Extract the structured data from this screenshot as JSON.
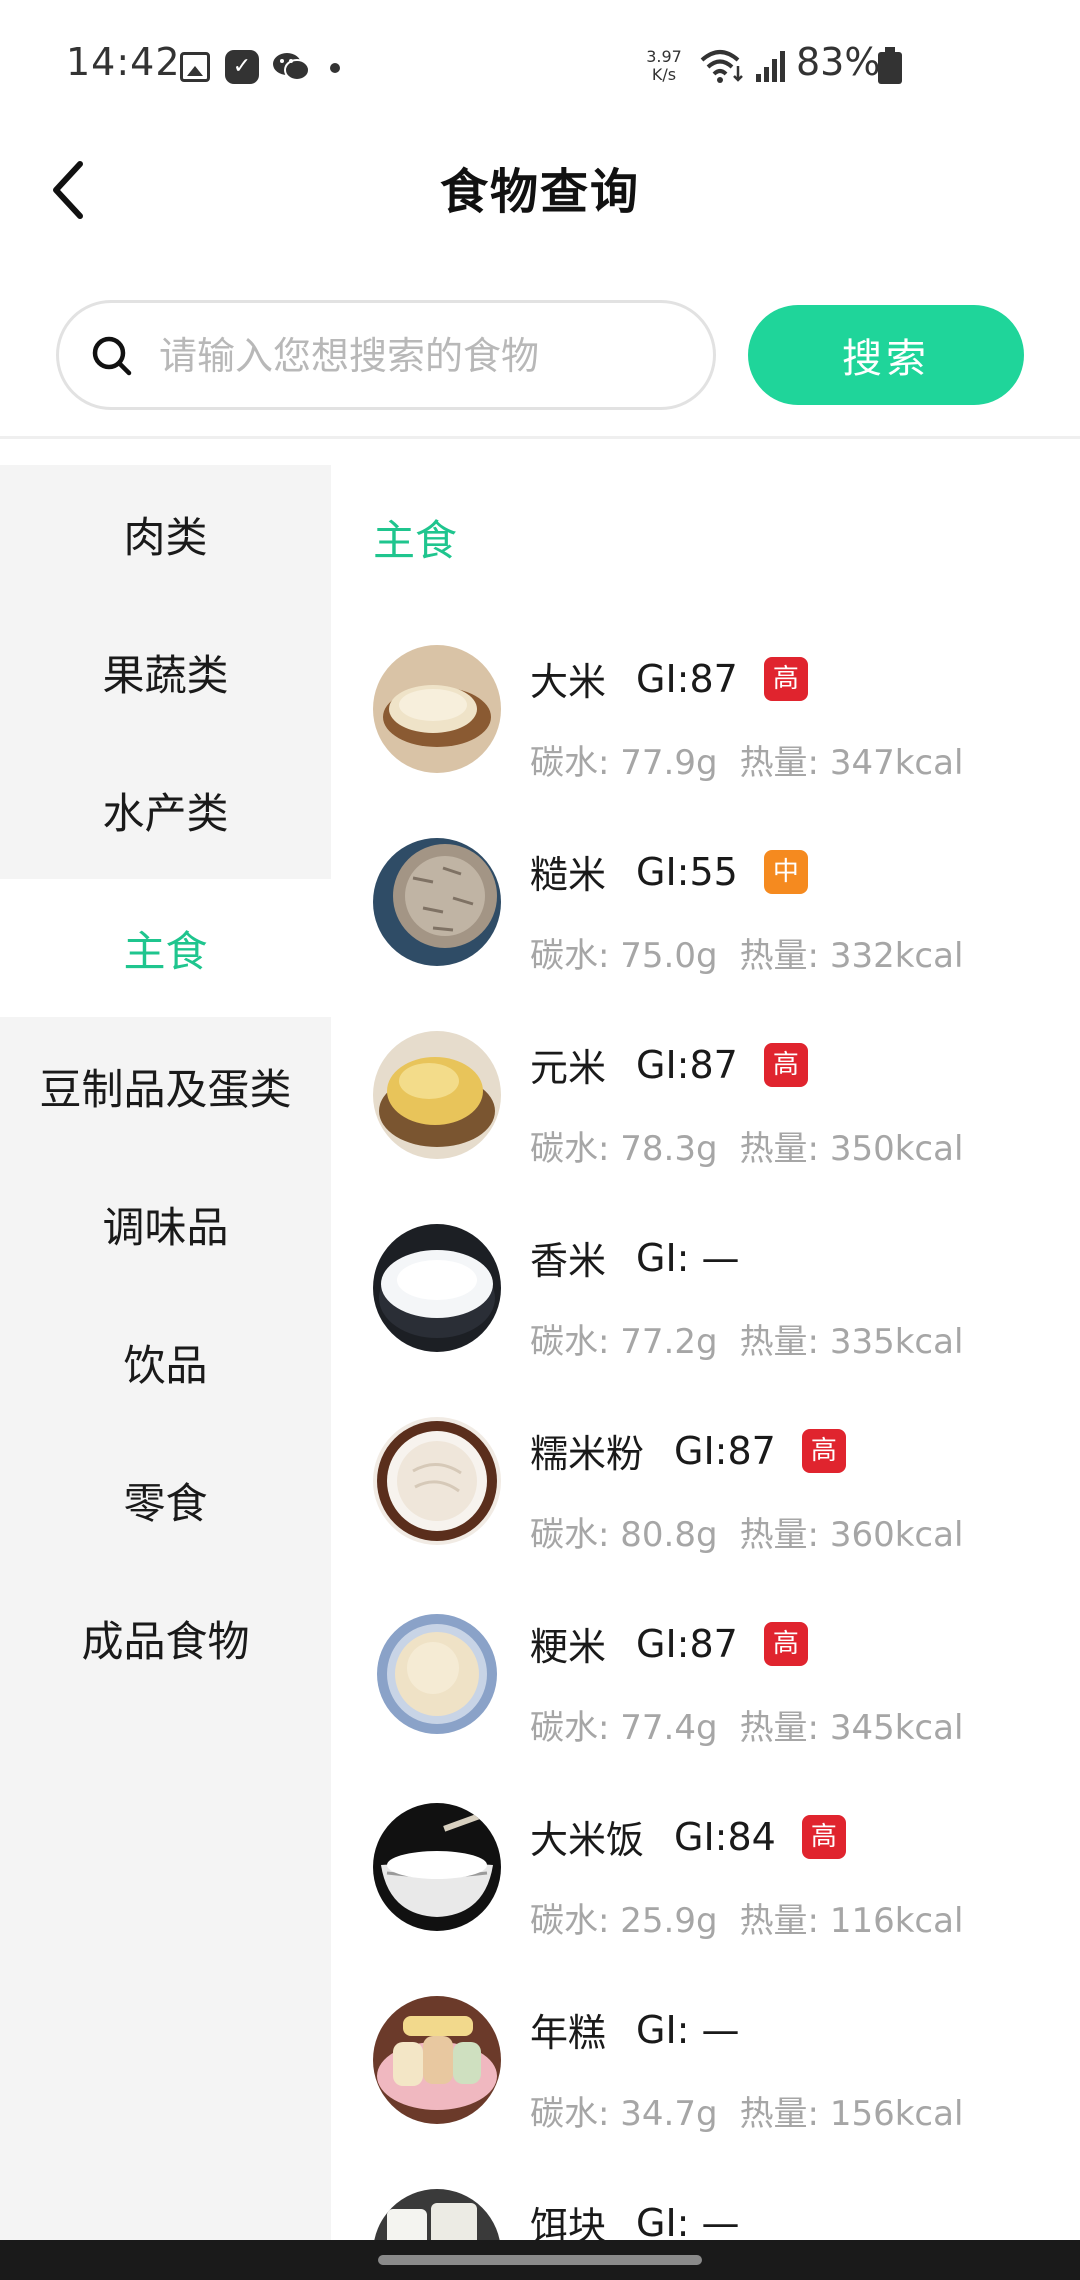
{
  "status_bar": {
    "time": "14:42",
    "speed_value": "3.97",
    "speed_unit": "K/s",
    "battery": "83%",
    "icons": [
      "gallery-icon",
      "check-app-icon",
      "wechat-icon",
      "dot-icon",
      "wifi-icon",
      "signal-icon",
      "battery-icon"
    ]
  },
  "header": {
    "title": "食物查询"
  },
  "search": {
    "placeholder": "请输入您想搜索的食物",
    "value": "",
    "button_label": "搜索"
  },
  "sidebar": {
    "items": [
      {
        "label": "肉类",
        "active": false
      },
      {
        "label": "果蔬类",
        "active": false
      },
      {
        "label": "水产类",
        "active": false
      },
      {
        "label": "主食",
        "active": true
      },
      {
        "label": "豆制品及蛋类",
        "active": false
      },
      {
        "label": "调味品",
        "active": false
      },
      {
        "label": "饮品",
        "active": false
      },
      {
        "label": "零食",
        "active": false
      },
      {
        "label": "成品食物",
        "active": false
      }
    ]
  },
  "content": {
    "section_title": "主食",
    "foods": [
      {
        "name": "大米",
        "gi": "GI:87",
        "level": "高",
        "carb": "碳水: 77.9g",
        "kcal": "热量: 347kcal"
      },
      {
        "name": "糙米",
        "gi": "GI:55",
        "level": "中",
        "carb": "碳水: 75.0g",
        "kcal": "热量: 332kcal"
      },
      {
        "name": "元米",
        "gi": "GI:87",
        "level": "高",
        "carb": "碳水: 78.3g",
        "kcal": "热量: 350kcal"
      },
      {
        "name": "香米",
        "gi": "GI: —",
        "level": "",
        "carb": "碳水: 77.2g",
        "kcal": "热量: 335kcal"
      },
      {
        "name": "糯米粉",
        "gi": "GI:87",
        "level": "高",
        "carb": "碳水: 80.8g",
        "kcal": "热量: 360kcal"
      },
      {
        "name": "粳米",
        "gi": "GI:87",
        "level": "高",
        "carb": "碳水: 77.4g",
        "kcal": "热量: 345kcal"
      },
      {
        "name": "大米饭",
        "gi": "GI:84",
        "level": "高",
        "carb": "碳水: 25.9g",
        "kcal": "热量: 116kcal"
      },
      {
        "name": "年糕",
        "gi": "GI: —",
        "level": "",
        "carb": "碳水: 34.7g",
        "kcal": "热量: 156kcal"
      },
      {
        "name": "饵块",
        "gi": "GI: —",
        "level": "",
        "carb": "",
        "kcal": ""
      }
    ]
  },
  "colors": {
    "accent": "#1fc58e",
    "button": "#1fd59a",
    "badge_high": "#e0242e",
    "badge_mid": "#f58a1f",
    "sidebar_bg": "#f4f4f4",
    "muted_text": "#a6a6a6"
  }
}
